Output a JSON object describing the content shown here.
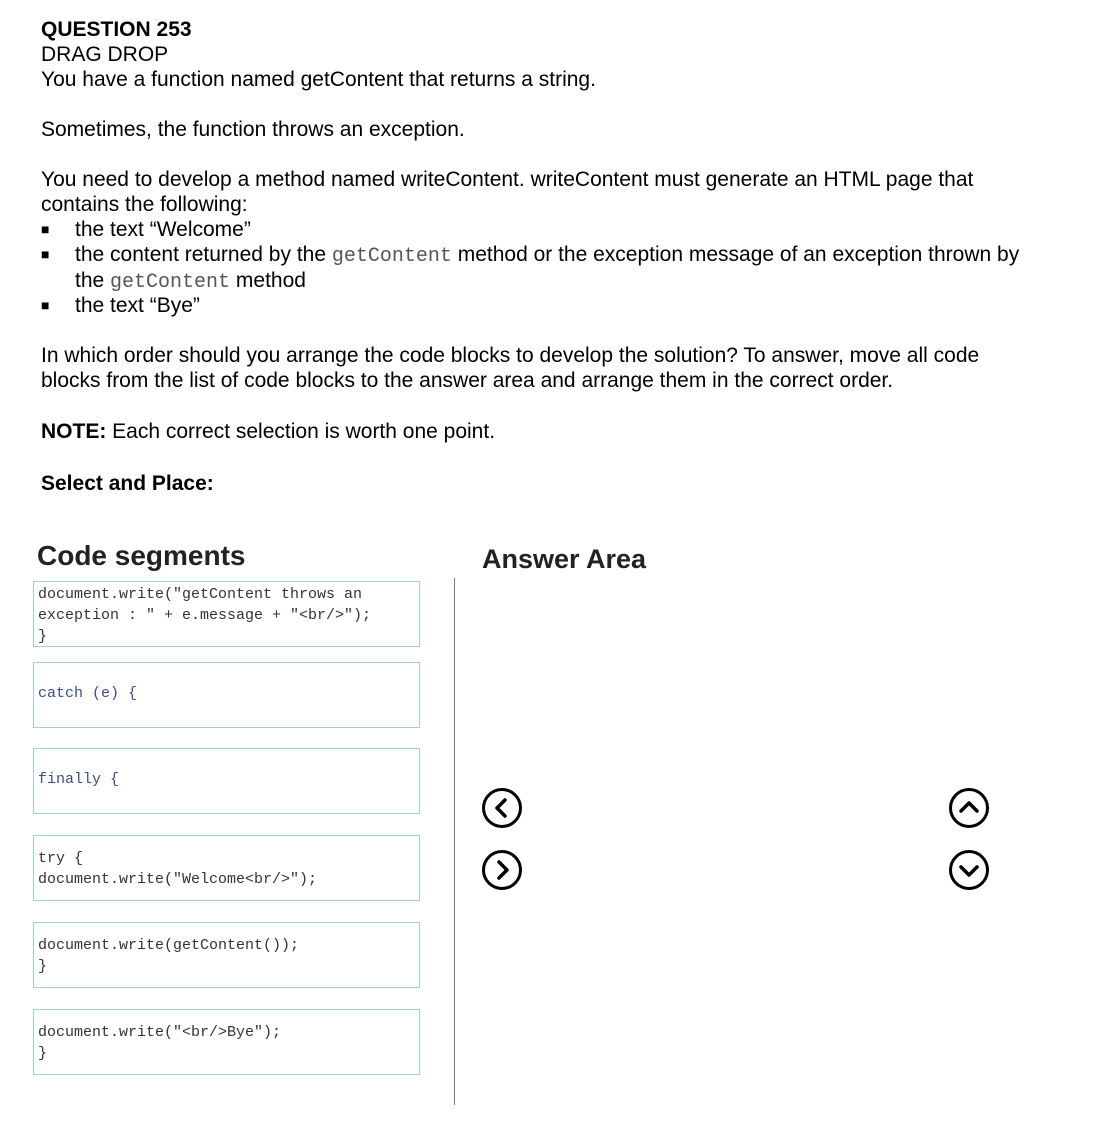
{
  "question": {
    "number": "QUESTION 253",
    "type": "DRAG DROP",
    "line1": "You have a function named getContent that returns a string.",
    "line2": "Sometimes, the function throws an exception.",
    "line3a": "You need to develop a method named writeContent. writeContent must generate an HTML page that",
    "line3b": "contains the following:",
    "bullets": {
      "b1": "the text “Welcome”",
      "b2_pre": "the content returned by the ",
      "b2_code": "getContent",
      "b2_post": " method or the exception message of an exception thrown by",
      "b2_line2_pre": "the ",
      "b2_line2_code": "getContent",
      "b2_line2_post": " method",
      "b3": "the text “Bye”"
    },
    "instruction_a": "In which order should you arrange the code blocks to develop the solution? To answer, move all code",
    "instruction_b": "blocks from the list of code blocks to the answer area and arrange them in the correct order.",
    "note_label": "NOTE:",
    "note_text": " Each correct selection is worth one point.",
    "select_place": "Select and Place:"
  },
  "code_segments": {
    "heading": "Code segments",
    "items": [
      {
        "lines": [
          "document.write(\"getContent throws an",
          "exception : \" + e.message + \"<br/>\");",
          "}"
        ]
      },
      {
        "lines": [
          "catch (e) {"
        ]
      },
      {
        "lines": [
          "finally {"
        ]
      },
      {
        "lines": [
          "try {",
          "document.write(\"Welcome<br/>\");"
        ]
      },
      {
        "lines": [
          "document.write(getContent());",
          "}"
        ]
      },
      {
        "lines": [
          "document.write(\"<br/>Bye\");",
          "}"
        ]
      }
    ]
  },
  "answer_area": {
    "heading": "Answer Area"
  },
  "icons": {
    "move_left": "chevron-left-circle-icon",
    "move_right": "chevron-right-circle-icon",
    "move_up": "chevron-up-circle-icon",
    "move_down": "chevron-down-circle-icon"
  }
}
